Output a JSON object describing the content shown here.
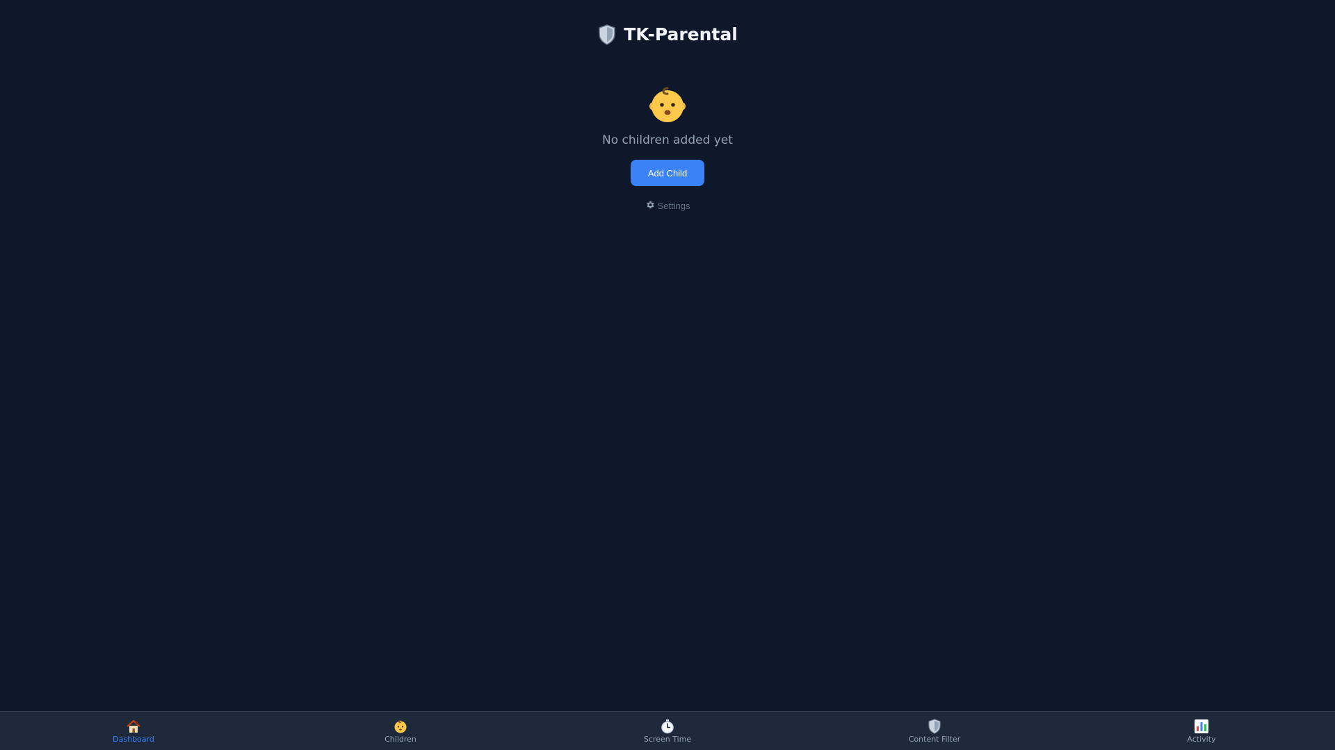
{
  "app": {
    "title": "TK-Parental",
    "logo_icon": "shield-icon"
  },
  "colors": {
    "background": "#0f172a",
    "nav_background": "#1e293b",
    "accent": "#3b82f6",
    "muted_text": "#94a3b8"
  },
  "empty_state": {
    "icon": "baby-icon",
    "message": "No children added yet",
    "add_button_label": "Add Child",
    "settings_icon": "gear-icon",
    "settings_label": "Settings"
  },
  "nav": {
    "active": "Dashboard",
    "items": [
      {
        "label": "Dashboard",
        "icon": "house-icon"
      },
      {
        "label": "Children",
        "icon": "baby-icon"
      },
      {
        "label": "Screen Time",
        "icon": "stopwatch-icon"
      },
      {
        "label": "Content Filter",
        "icon": "shield-icon"
      },
      {
        "label": "Activity",
        "icon": "bar-chart-icon"
      }
    ]
  }
}
